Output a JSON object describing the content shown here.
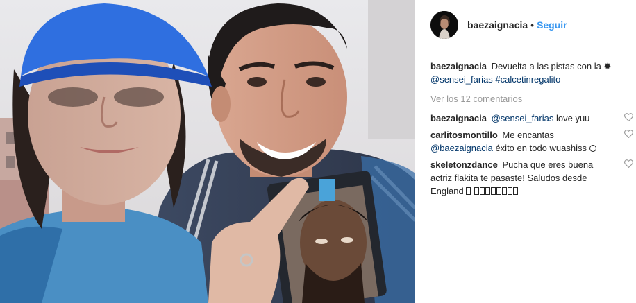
{
  "post": {
    "author": "baezaignacia",
    "dot": "•",
    "follow_label": "Seguir",
    "photo_alt": "selfie"
  },
  "caption": {
    "username": "baezaignacia",
    "text": "Devuelta a las pistas con la",
    "emoji": "star-emoji",
    "mention": "@sensei_farias",
    "hashtag": "#calcetinregalito"
  },
  "view_all_comments": "Ver los 12 comentarios",
  "comments": [
    {
      "username": "baezaignacia",
      "mention": "@sensei_farias",
      "text": "love yuu"
    },
    {
      "username": "carlitosmontillo",
      "text_before": "Me encantas",
      "mention": "@baezaignacia",
      "text_after": "éxito en todo wuashiss",
      "emoji": "face-emoji"
    },
    {
      "username": "skeletonzdance",
      "text": "Pucha que eres buena actriz flakita te pasaste! Saludos desde England",
      "emoji_boxes": 9
    }
  ],
  "colors": {
    "link_blue": "#3897f0",
    "mention_blue": "#003569",
    "muted_gray": "#999999",
    "divider": "#efefef",
    "text": "#262626"
  }
}
